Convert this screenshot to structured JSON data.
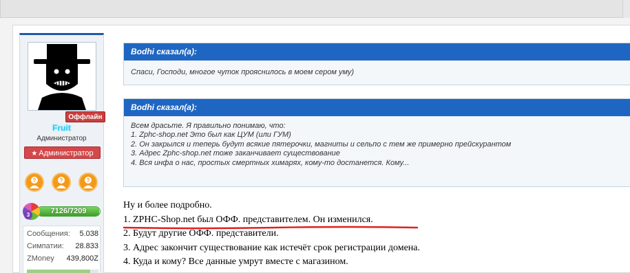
{
  "user": {
    "status_badge": "Оффлайн",
    "username": "Fruit",
    "title": "Администратор",
    "role": "Администратор",
    "trophies": [
      "trophy-question-person-icon",
      "trophy-question-person-icon",
      "trophy-question-person-icon"
    ],
    "level": {
      "number": "3",
      "xp_text": "7126/7209",
      "progress": 0.988
    },
    "stats": [
      {
        "label": "Сообщения:",
        "value": "5.038"
      },
      {
        "label": "Симпатии:",
        "value": "28.833"
      },
      {
        "label": "ZMoney",
        "value": "439,800Z"
      }
    ]
  },
  "quotes": [
    {
      "author": "Bodhi сказал(а):",
      "lines": [
        "Спаси, Господи, многое чуток прояснилось в моем сером уму)"
      ]
    },
    {
      "author": "Bodhi сказал(а):",
      "lines": [
        "Всем драсьте. Я правильно понимаю, что:",
        "1. Zphc-shop.net Это был как ЦУМ (или ГУМ)",
        "2. Он закрылся и теперь будут всякие пятерочки, магниты и сельпо с тем же примерно прейскурантом",
        "3. Адрес Zphc-shop.net тоже заканчивает существование",
        "4. Вся инфа о нас, простых смертных химарях, кому-то достанется. Кому..."
      ]
    }
  ],
  "reply": {
    "lines": [
      "Ну и более подробно.",
      "1. ZPHC-Shop.net был ОФФ. представителем. Он изменился.",
      "2. Будут другие ОФФ. представители.",
      "3. Адрес закончит существование как истечёт срок регистрации домена.",
      "4. Куда и кому? Все данные умрут вместе с магазином."
    ]
  },
  "colors": {
    "quote_header": "#1f66c2",
    "offline_badge": "#c83f3f",
    "role_banner": "#d4474a",
    "username": "#31c6f5",
    "underline": "#e02020"
  }
}
